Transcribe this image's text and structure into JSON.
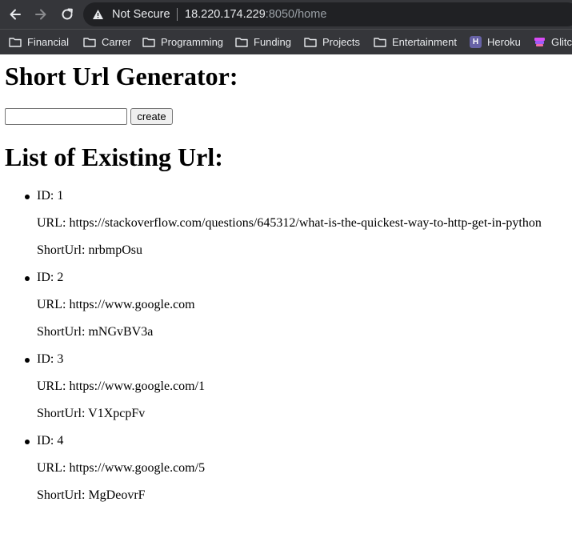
{
  "browser": {
    "security_label": "Not Secure",
    "url_host": "18.220.174.229",
    "url_path": ":8050/home",
    "bookmarks": [
      {
        "label": "Financial",
        "icon": "folder-icon"
      },
      {
        "label": "Carrer",
        "icon": "folder-icon"
      },
      {
        "label": "Programming",
        "icon": "folder-icon"
      },
      {
        "label": "Funding",
        "icon": "folder-icon"
      },
      {
        "label": "Projects",
        "icon": "folder-icon"
      },
      {
        "label": "Entertainment",
        "icon": "folder-icon"
      },
      {
        "label": "Heroku",
        "icon": "heroku-icon"
      },
      {
        "label": "Glitch",
        "icon": "glitch-icon"
      }
    ]
  },
  "page": {
    "title": "Short Url Generator:",
    "input": {
      "value": "",
      "placeholder": ""
    },
    "create_label": "create",
    "list_title": "List of Existing Url:",
    "entries": [
      {
        "id": "ID: 1",
        "url": "URL: https://stackoverflow.com/questions/645312/what-is-the-quickest-way-to-http-get-in-python",
        "short": "ShortUrl: nrbmpOsu"
      },
      {
        "id": "ID: 2",
        "url": "URL: https://www.google.com",
        "short": "ShortUrl: mNGvBV3a"
      },
      {
        "id": "ID: 3",
        "url": "URL: https://www.google.com/1",
        "short": "ShortUrl: V1XpcpFv"
      },
      {
        "id": "ID: 4",
        "url": "URL: https://www.google.com/5",
        "short": "ShortUrl: MgDeovrF"
      }
    ]
  }
}
